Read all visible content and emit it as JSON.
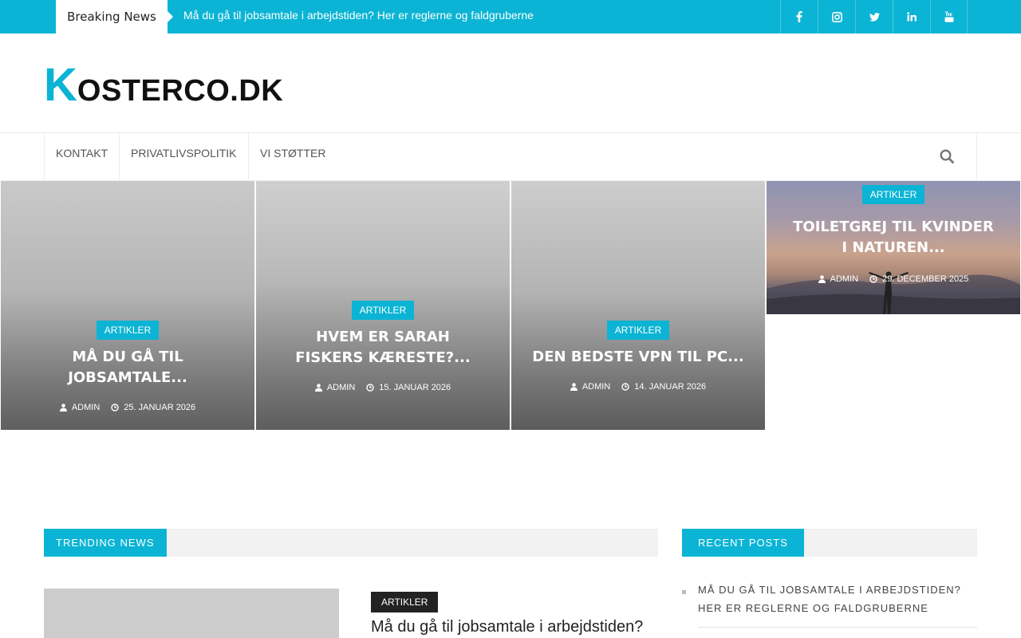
{
  "topbar": {
    "breaking_label": "Breaking News",
    "ticker_text": "Må du gå til jobsamtale i arbejdstiden? Her er reglerne og faldgruberne",
    "social": [
      {
        "icon": "facebook-icon",
        "glyph": "f"
      },
      {
        "icon": "instagram-icon",
        "glyph": ""
      },
      {
        "icon": "twitter-icon",
        "glyph": ""
      },
      {
        "icon": "linkedin-icon",
        "glyph": "in"
      },
      {
        "icon": "youtube-icon",
        "glyph": ""
      }
    ]
  },
  "logo": {
    "first_letter": "K",
    "rest": "OSTERCO.DK"
  },
  "nav": {
    "items": [
      "KONTAKT",
      "PRIVATLIVSPOLITIK",
      "VI STØTTER"
    ],
    "search_icon": "search-icon"
  },
  "featured": [
    {
      "category": "ARTIKLER",
      "title": "MÅ DU GÅ TIL JOBSAMTALE...",
      "author": "ADMIN",
      "date": "25. JANUAR 2026"
    },
    {
      "category": "ARTIKLER",
      "title": "HVEM ER SARAH FISKERS KÆRESTE?...",
      "author": "ADMIN",
      "date": "15. JANUAR 2026"
    },
    {
      "category": "ARTIKLER",
      "title": "DEN BEDSTE VPN TIL PC...",
      "author": "ADMIN",
      "date": "14. JANUAR 2026"
    },
    {
      "category": "ARTIKLER",
      "title": "TOILETGREJ TIL KVINDER I NATUREN...",
      "author": "ADMIN",
      "date": "29. DECEMBER 2025"
    }
  ],
  "trending": {
    "label": "TRENDING NEWS",
    "post": {
      "category": "ARTIKLER",
      "title": "Må du gå til jobsamtale i arbejdstiden?"
    }
  },
  "recent": {
    "label": "RECENT POSTS",
    "items": [
      "MÅ DU GÅ TIL JOBSAMTALE I ARBEJDSTIDEN? HER ER REGLERNE OG FALDGRUBERNE"
    ]
  },
  "colors": {
    "accent": "#0bb4d4",
    "dark": "#222222"
  }
}
